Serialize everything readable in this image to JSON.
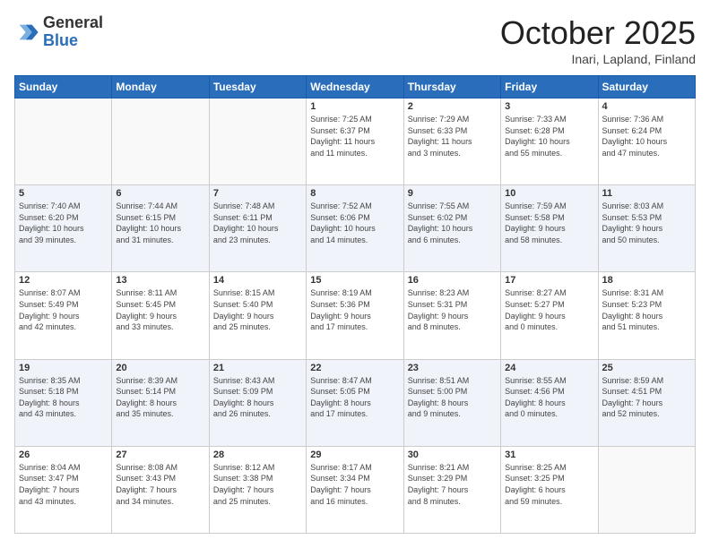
{
  "logo": {
    "general": "General",
    "blue": "Blue"
  },
  "header": {
    "month": "October 2025",
    "location": "Inari, Lapland, Finland"
  },
  "weekdays": [
    "Sunday",
    "Monday",
    "Tuesday",
    "Wednesday",
    "Thursday",
    "Friday",
    "Saturday"
  ],
  "weeks": [
    [
      {
        "day": "",
        "info": ""
      },
      {
        "day": "",
        "info": ""
      },
      {
        "day": "",
        "info": ""
      },
      {
        "day": "1",
        "info": "Sunrise: 7:25 AM\nSunset: 6:37 PM\nDaylight: 11 hours\nand 11 minutes."
      },
      {
        "day": "2",
        "info": "Sunrise: 7:29 AM\nSunset: 6:33 PM\nDaylight: 11 hours\nand 3 minutes."
      },
      {
        "day": "3",
        "info": "Sunrise: 7:33 AM\nSunset: 6:28 PM\nDaylight: 10 hours\nand 55 minutes."
      },
      {
        "day": "4",
        "info": "Sunrise: 7:36 AM\nSunset: 6:24 PM\nDaylight: 10 hours\nand 47 minutes."
      }
    ],
    [
      {
        "day": "5",
        "info": "Sunrise: 7:40 AM\nSunset: 6:20 PM\nDaylight: 10 hours\nand 39 minutes."
      },
      {
        "day": "6",
        "info": "Sunrise: 7:44 AM\nSunset: 6:15 PM\nDaylight: 10 hours\nand 31 minutes."
      },
      {
        "day": "7",
        "info": "Sunrise: 7:48 AM\nSunset: 6:11 PM\nDaylight: 10 hours\nand 23 minutes."
      },
      {
        "day": "8",
        "info": "Sunrise: 7:52 AM\nSunset: 6:06 PM\nDaylight: 10 hours\nand 14 minutes."
      },
      {
        "day": "9",
        "info": "Sunrise: 7:55 AM\nSunset: 6:02 PM\nDaylight: 10 hours\nand 6 minutes."
      },
      {
        "day": "10",
        "info": "Sunrise: 7:59 AM\nSunset: 5:58 PM\nDaylight: 9 hours\nand 58 minutes."
      },
      {
        "day": "11",
        "info": "Sunrise: 8:03 AM\nSunset: 5:53 PM\nDaylight: 9 hours\nand 50 minutes."
      }
    ],
    [
      {
        "day": "12",
        "info": "Sunrise: 8:07 AM\nSunset: 5:49 PM\nDaylight: 9 hours\nand 42 minutes."
      },
      {
        "day": "13",
        "info": "Sunrise: 8:11 AM\nSunset: 5:45 PM\nDaylight: 9 hours\nand 33 minutes."
      },
      {
        "day": "14",
        "info": "Sunrise: 8:15 AM\nSunset: 5:40 PM\nDaylight: 9 hours\nand 25 minutes."
      },
      {
        "day": "15",
        "info": "Sunrise: 8:19 AM\nSunset: 5:36 PM\nDaylight: 9 hours\nand 17 minutes."
      },
      {
        "day": "16",
        "info": "Sunrise: 8:23 AM\nSunset: 5:31 PM\nDaylight: 9 hours\nand 8 minutes."
      },
      {
        "day": "17",
        "info": "Sunrise: 8:27 AM\nSunset: 5:27 PM\nDaylight: 9 hours\nand 0 minutes."
      },
      {
        "day": "18",
        "info": "Sunrise: 8:31 AM\nSunset: 5:23 PM\nDaylight: 8 hours\nand 51 minutes."
      }
    ],
    [
      {
        "day": "19",
        "info": "Sunrise: 8:35 AM\nSunset: 5:18 PM\nDaylight: 8 hours\nand 43 minutes."
      },
      {
        "day": "20",
        "info": "Sunrise: 8:39 AM\nSunset: 5:14 PM\nDaylight: 8 hours\nand 35 minutes."
      },
      {
        "day": "21",
        "info": "Sunrise: 8:43 AM\nSunset: 5:09 PM\nDaylight: 8 hours\nand 26 minutes."
      },
      {
        "day": "22",
        "info": "Sunrise: 8:47 AM\nSunset: 5:05 PM\nDaylight: 8 hours\nand 17 minutes."
      },
      {
        "day": "23",
        "info": "Sunrise: 8:51 AM\nSunset: 5:00 PM\nDaylight: 8 hours\nand 9 minutes."
      },
      {
        "day": "24",
        "info": "Sunrise: 8:55 AM\nSunset: 4:56 PM\nDaylight: 8 hours\nand 0 minutes."
      },
      {
        "day": "25",
        "info": "Sunrise: 8:59 AM\nSunset: 4:51 PM\nDaylight: 7 hours\nand 52 minutes."
      }
    ],
    [
      {
        "day": "26",
        "info": "Sunrise: 8:04 AM\nSunset: 3:47 PM\nDaylight: 7 hours\nand 43 minutes."
      },
      {
        "day": "27",
        "info": "Sunrise: 8:08 AM\nSunset: 3:43 PM\nDaylight: 7 hours\nand 34 minutes."
      },
      {
        "day": "28",
        "info": "Sunrise: 8:12 AM\nSunset: 3:38 PM\nDaylight: 7 hours\nand 25 minutes."
      },
      {
        "day": "29",
        "info": "Sunrise: 8:17 AM\nSunset: 3:34 PM\nDaylight: 7 hours\nand 16 minutes."
      },
      {
        "day": "30",
        "info": "Sunrise: 8:21 AM\nSunset: 3:29 PM\nDaylight: 7 hours\nand 8 minutes."
      },
      {
        "day": "31",
        "info": "Sunrise: 8:25 AM\nSunset: 3:25 PM\nDaylight: 6 hours\nand 59 minutes."
      },
      {
        "day": "",
        "info": ""
      }
    ]
  ]
}
